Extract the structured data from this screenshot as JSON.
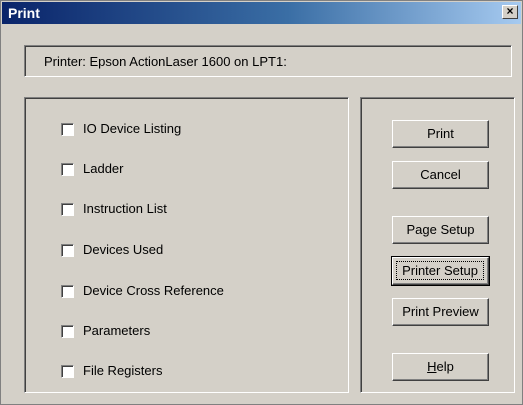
{
  "window": {
    "title": "Print",
    "close_glyph": "×"
  },
  "printer": {
    "label": "Printer: Epson ActionLaser 1600 on LPT1:"
  },
  "options": [
    {
      "label": "IO Device Listing",
      "checked": false
    },
    {
      "label": "Ladder",
      "checked": false
    },
    {
      "label": "Instruction List",
      "checked": false
    },
    {
      "label": "Devices Used",
      "checked": false
    },
    {
      "label": "Device Cross Reference",
      "checked": false
    },
    {
      "label": "Parameters",
      "checked": false
    },
    {
      "label": "File Registers",
      "checked": false
    }
  ],
  "buttons": {
    "print": "Print",
    "cancel": "Cancel",
    "page_setup": "Page Setup",
    "printer_setup": "Printer Setup",
    "print_preview": "Print Preview",
    "help_mnemonic": "H",
    "help_rest": "elp"
  }
}
